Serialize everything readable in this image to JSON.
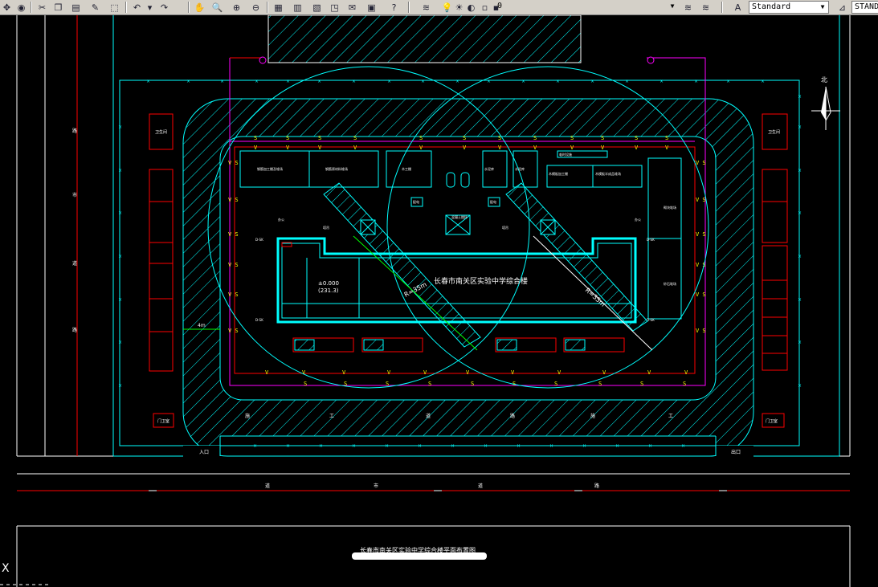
{
  "toolbar": {
    "layer_name": "0",
    "text_style": "Standard",
    "dim_style": "STAND",
    "icons": [
      "pan-icon",
      "orbit-icon",
      "cut-icon",
      "copy-icon",
      "paste-icon",
      "match-properties-icon",
      "block-editor-icon",
      "undo-icon",
      "redo-icon",
      "pan-realtime-icon",
      "zoom-realtime-icon",
      "zoom-window-icon",
      "zoom-previous-icon",
      "properties-icon",
      "design-center-icon",
      "tool-palettes-icon",
      "sheet-set-icon",
      "markup-icon",
      "calculator-icon",
      "help-icon",
      "layer-manager-icon",
      "lightbulb-icon",
      "sun-icon",
      "lock-icon",
      "color-swatch-icon",
      "layer-previous-icon",
      "layer-states-icon",
      "text-style-icon",
      "dim-style-icon"
    ]
  },
  "drawing": {
    "title": "长春市南关区实验中学综合楼平面布置图",
    "building_label": "长春市南关区实验中学综合楼",
    "crane_radius_left": "R=35m",
    "crane_radius_right": "R=35m",
    "elevation_label": "±0.000",
    "elevation_sub": "(231.3)",
    "dim_4m": "4m",
    "north_label": "北",
    "left_gate": "门卫室",
    "right_gate": "门卫室",
    "top_left_box": "卫生间",
    "top_right_box": "卫生间"
  },
  "colors": {
    "background": "#000000",
    "cyan": "#00ffff",
    "red": "#ff0000",
    "magenta": "#ff00ff",
    "white": "#ffffff",
    "yellow": "#ffff00",
    "green": "#00ff00"
  }
}
